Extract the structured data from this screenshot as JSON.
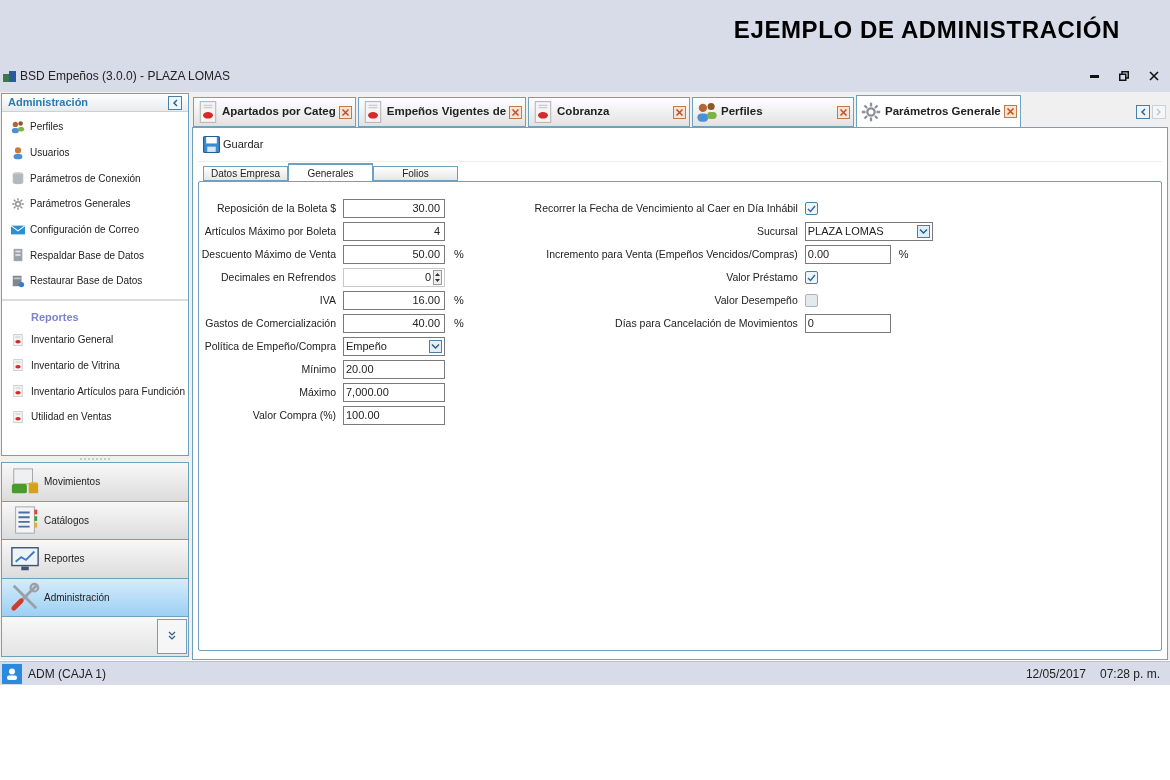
{
  "banner": "EJEMPLO DE ADMINISTRACIÓN",
  "window": {
    "title": "BSD Empeños (3.0.0) - PLAZA LOMAS"
  },
  "sidebar": {
    "title": "Administración",
    "items": [
      {
        "label": "Perfiles"
      },
      {
        "label": "Usuarios"
      },
      {
        "label": "Parámetros de Conexión"
      },
      {
        "label": "Parámetros Generales"
      },
      {
        "label": "Configuración de Correo"
      },
      {
        "label": "Respaldar Base de Datos"
      },
      {
        "label": "Restaurar Base de Datos"
      }
    ],
    "reports_title": "Reportes",
    "reports": [
      {
        "label": "Inventario General"
      },
      {
        "label": "Inventario de Vitrina"
      },
      {
        "label": "Inventario Artículos para Fundición"
      },
      {
        "label": "Utilidad en Ventas"
      }
    ],
    "nav": [
      {
        "label": "Movimientos",
        "selected": false
      },
      {
        "label": "Catálogos",
        "selected": false
      },
      {
        "label": "Reportes",
        "selected": false
      },
      {
        "label": "Administración",
        "selected": true
      }
    ]
  },
  "doc_tabs": [
    {
      "label": "Apartados por Categ",
      "selected": false
    },
    {
      "label": "Empeños Vigentes de",
      "selected": false
    },
    {
      "label": "Cobranza",
      "selected": false
    },
    {
      "label": "Perfiles",
      "selected": false
    },
    {
      "label": "Parámetros Generale",
      "selected": true
    }
  ],
  "toolbar": {
    "save": "Guardar"
  },
  "form_tabs": [
    {
      "label": "Datos Empresa",
      "selected": false
    },
    {
      "label": "Generales",
      "selected": true
    },
    {
      "label": "Folios",
      "selected": false
    }
  ],
  "left_fields": [
    {
      "label": "Reposición de la Boleta $",
      "kind": "number",
      "value": "30.00"
    },
    {
      "label": "Artículos Máximo por Boleta",
      "kind": "number",
      "value": "4"
    },
    {
      "label": "Descuento Máximo de Venta",
      "kind": "number",
      "value": "50.00",
      "suffix": "%"
    },
    {
      "label": "Decimales en Refrendos",
      "kind": "spinner",
      "value": "0"
    },
    {
      "label": "IVA",
      "kind": "number",
      "value": "16.00",
      "suffix": "%"
    },
    {
      "label": "Gastos de Comercialización",
      "kind": "number",
      "value": "40.00",
      "suffix": "%"
    },
    {
      "label": "Política de Empeño/Compra",
      "kind": "select",
      "value": "Empeño"
    },
    {
      "label": "Mínimo",
      "kind": "text",
      "value": "20.00"
    },
    {
      "label": "Máximo",
      "kind": "text",
      "value": "7,000.00"
    },
    {
      "label": "Valor Compra (%)",
      "kind": "text",
      "value": "100.00"
    }
  ],
  "right_fields": [
    {
      "label": "Recorrer la Fecha de Vencimiento al Caer en Día Inhábil",
      "kind": "checkbox",
      "checked": true
    },
    {
      "label": "Sucursal",
      "kind": "select",
      "value": "PLAZA LOMAS"
    },
    {
      "label": "Incremento para Venta (Empeños Vencidos/Compras)",
      "kind": "text",
      "value": "0.00",
      "suffix": "%"
    },
    {
      "label": "Valor Préstamo",
      "kind": "checkbox",
      "checked": true
    },
    {
      "label": "Valor Desempeño",
      "kind": "checkbox",
      "checked": false
    },
    {
      "label": "Días para Cancelación de Movimientos",
      "kind": "text",
      "value": "0"
    }
  ],
  "status_bar": {
    "user": "ADM (CAJA 1)",
    "date": "12/05/2017",
    "time": "07:28 p. m."
  }
}
